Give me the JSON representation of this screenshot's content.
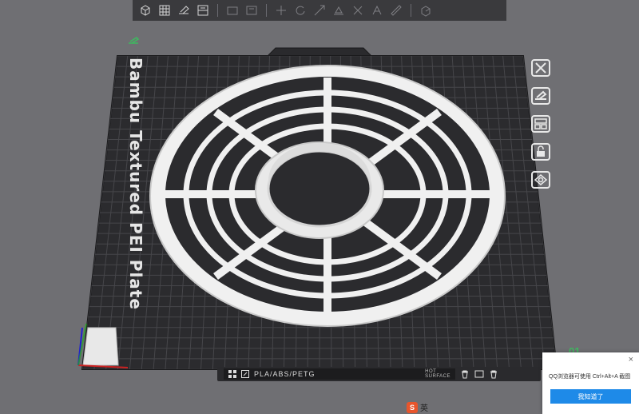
{
  "toolbar": {
    "buttons": [
      {
        "name": "add-cube-icon"
      },
      {
        "name": "grid-arrange-icon"
      },
      {
        "name": "orient-icon"
      },
      {
        "name": "split-icon"
      },
      {
        "name": "sep"
      },
      {
        "name": "layer-icon"
      },
      {
        "name": "object-icon"
      },
      {
        "name": "sep"
      },
      {
        "name": "move-icon"
      },
      {
        "name": "rotate-icon"
      },
      {
        "name": "scale-icon"
      },
      {
        "name": "lay-on-face-icon"
      },
      {
        "name": "cut-icon"
      },
      {
        "name": "support-paint-icon"
      },
      {
        "name": "seam-paint-icon"
      },
      {
        "name": "sep"
      },
      {
        "name": "assembly-icon"
      }
    ]
  },
  "plate": {
    "label": "Bambu Textured PEI Plate",
    "number": "01"
  },
  "bottom_bar": {
    "filament": "PLA/ABS/PETG",
    "hot_surface_line1": "HOT",
    "hot_surface_line2": "SURFACE"
  },
  "popup": {
    "close": "×",
    "message": "QQ浏览器可使用 Ctrl+Alt+A 截图",
    "button": "我知道了"
  },
  "ime": {
    "logo": "S",
    "text": "英"
  },
  "colors": {
    "background": "#6f6f73",
    "plate": "#2b2b2e",
    "grid": "#4a4a4e",
    "model": "#f2f2f2",
    "accent_green": "#3fb860",
    "popup_button": "#1e8ae8"
  }
}
